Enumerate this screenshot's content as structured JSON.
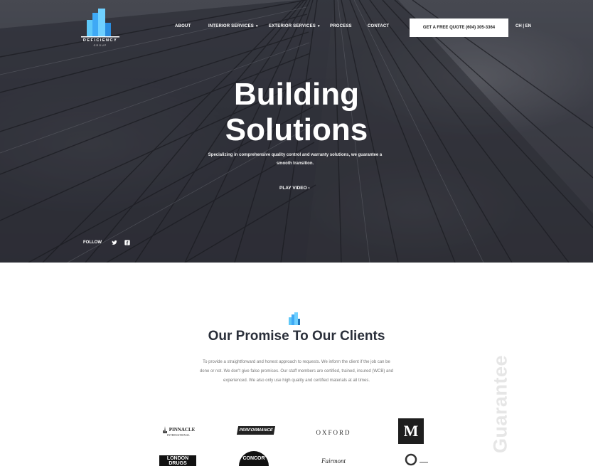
{
  "header": {
    "logo": {
      "brand": "DEFICIENCY",
      "tagline": "GROUP"
    },
    "nav": [
      {
        "label": "ABOUT",
        "has_dropdown": false
      },
      {
        "label": "INTERIOR SERVICES",
        "has_dropdown": true
      },
      {
        "label": "EXTERIOR SERVICES",
        "has_dropdown": true
      },
      {
        "label": "PROCESS",
        "has_dropdown": false
      },
      {
        "label": "CONTACT",
        "has_dropdown": false
      }
    ],
    "quote_button": "GET A FREE QUOTE (604) 305-3364",
    "language": "CH  |  EN"
  },
  "hero": {
    "title_line1": "Building",
    "title_line2": "Solutions",
    "subtitle": "Specializing in comprehensive quality control and warranty solutions, we guarantee a smooth transition.",
    "play_video": "PLAY VIDEO ›",
    "follow": "FOLLOW",
    "social": [
      {
        "icon": "twitter-icon",
        "glyph": "🐦"
      },
      {
        "icon": "facebook-icon",
        "glyph": "f"
      }
    ]
  },
  "promise": {
    "title": "Our Promise To Our Clients",
    "text": "To provide a straightforward and honest approach to requests. We inform the client if the job can be done or not. We don't give false promises. Our staff members are certified, trained, insured (WCB) and experienced. We also only use high quality and certified materials at all times.",
    "side_word": "Guarantee"
  },
  "clients": {
    "pinnacle": {
      "name": "PINNACLE",
      "sub": "INTERNATIONAL"
    },
    "performance": "PERFORMANCE",
    "oxford": "OXFORD",
    "mcdonalds": "M",
    "london_drugs": "LONDON DRUGS",
    "concor": "CONCOR",
    "fairmont": "Fairmont"
  },
  "colors": {
    "accent": "#3fa9f5",
    "accent_dark": "#1c75bc",
    "text_dark": "#2a2f3a"
  }
}
